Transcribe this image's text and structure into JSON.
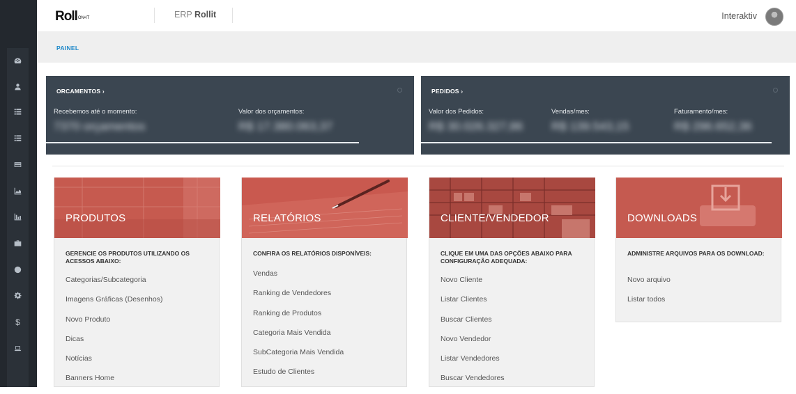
{
  "brand": {
    "logo_main": "Roll",
    "logo_sub": "ON•IT",
    "app_prefix": "ERP",
    "app_name": "Rollit"
  },
  "user": {
    "name": "Interaktiv"
  },
  "breadcrumb": {
    "label": "PAINEL"
  },
  "sidebar": {
    "items": [
      {
        "icon": "dashboard-icon"
      },
      {
        "icon": "user-icon"
      },
      {
        "icon": "list-icon"
      },
      {
        "icon": "list-icon"
      },
      {
        "icon": "credit-card-icon"
      },
      {
        "icon": "area-chart-icon"
      },
      {
        "icon": "bar-chart-icon"
      },
      {
        "icon": "briefcase-icon"
      },
      {
        "icon": "globe-icon"
      },
      {
        "icon": "gear-icon"
      },
      {
        "icon": "dollar-icon"
      },
      {
        "icon": "laptop-icon"
      }
    ]
  },
  "orcamentos": {
    "title": "ORCAMENTOS",
    "label1": "Recebemos até o momento:",
    "value1": "7370 orçamentos",
    "label2": "Valor dos orçamentos:",
    "value2": "R$ 17.380.063,37",
    "progress": 0.85
  },
  "pedidos": {
    "title": "PEDIDOS",
    "label1": "Valor dos Pedidos:",
    "value1": "R$ 30.026.327,86",
    "label2": "Vendas/mes:",
    "value2": "R$ 139.543,15",
    "label3": "Faturamento/mes:",
    "value3": "R$ 296.652,36",
    "progress": 0.95
  },
  "cards": {
    "produtos": {
      "title": "PRODUTOS",
      "desc": "GERENCIE OS PRODUTOS UTILIZANDO OS ACESSOS ABAIXO:",
      "links": [
        "Categorias/Subcategoria",
        "Imagens Gráficas (Desenhos)",
        "Novo Produto",
        "Dicas",
        "Notícias",
        "Banners Home"
      ]
    },
    "relatorios": {
      "title": "RELATÓRIOS",
      "desc": "CONFIRA OS RELATÓRIOS DISPONÍVEIS:",
      "links": [
        "Vendas",
        "Ranking de Vendedores",
        "Ranking de Produtos",
        "Categoria Mais Vendida",
        "SubCategoria Mais Vendida",
        "Estudo de Clientes"
      ]
    },
    "cliente": {
      "title": "CLIENTE/VENDEDOR",
      "desc": "CLIQUE EM UMA DAS OPÇÕES ABAIXO PARA CONFIGURAÇÃO ADEQUADA:",
      "links": [
        "Novo Cliente",
        "Listar Clientes",
        "Buscar Clientes",
        "Novo Vendedor",
        "Listar Vendedores",
        "Buscar Vendedores"
      ]
    },
    "downloads": {
      "title": "DOWNLOADS",
      "desc": "ADMINISTRE ARQUIVOS PARA OS DOWNLOAD:",
      "links": [
        "Novo arquivo",
        "Listar todos"
      ]
    }
  },
  "colors": {
    "accent": "#1e88c9",
    "panel": "#3b4651",
    "card_hero": "#c4584e",
    "sidebar": "#23282e"
  }
}
